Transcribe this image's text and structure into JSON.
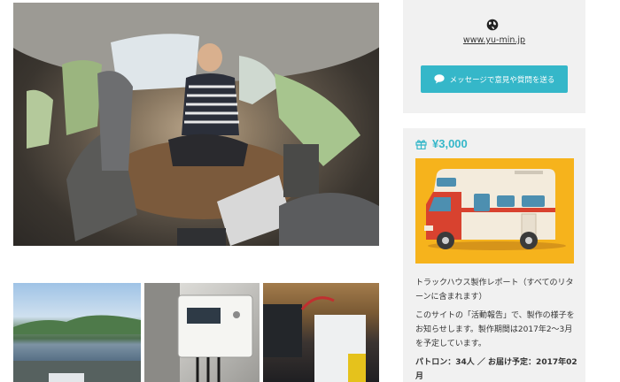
{
  "profile": {
    "website_link": "www.yu-min.jp",
    "message_button_label": "メッセージで意見や質問を送る",
    "globe_icon": "globe-icon",
    "chat_icon": "chat-bubble-icon"
  },
  "reward": {
    "gift_icon": "gift-icon",
    "price": "¥3,000",
    "title": "トラックハウス製作レポート（すべてのリターンに含まれます）",
    "description": "このサイトの「活動報告」で、製作の様子をお知らせします。製作期間は2017年2〜3月を予定しています。",
    "meta": "パトロン：34人 ／ お届け予定：2017年02月"
  },
  "colors": {
    "accent": "#35b7c9",
    "card_bg": "#f1f1f1",
    "illustration_bg": "#f6b31c"
  }
}
